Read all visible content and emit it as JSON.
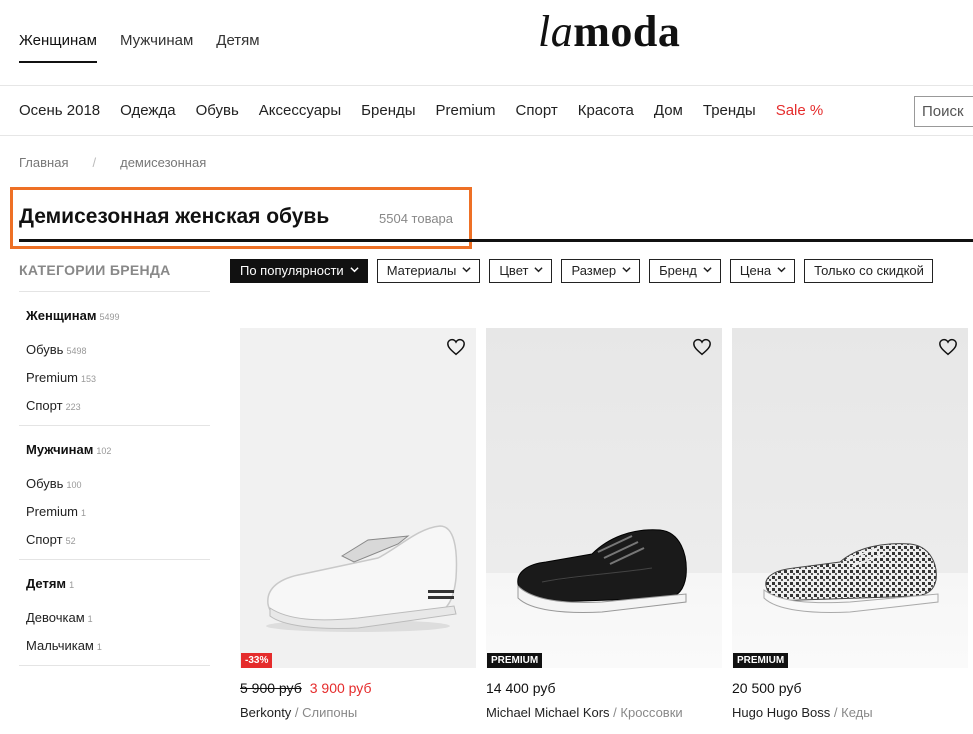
{
  "header": {
    "gender_tabs": [
      "Женщинам",
      "Мужчинам",
      "Детям"
    ],
    "logo": {
      "la": "la",
      "moda": "moda"
    }
  },
  "nav": {
    "items": [
      "Осень 2018",
      "Одежда",
      "Обувь",
      "Аксессуары",
      "Бренды",
      "Premium",
      "Спорт",
      "Красота",
      "Дом",
      "Тренды"
    ],
    "sale": "Sale %",
    "search_text": "Поиск"
  },
  "breadcrumb": {
    "home": "Главная",
    "sep": "/",
    "current": "демисезонная"
  },
  "page": {
    "title": "Демисезонная женская обувь",
    "count": "5504 товара",
    "highlight_color": "#ee7025"
  },
  "sidebar": {
    "heading": "КАТЕГОРИИ БРЕНДА",
    "groups": [
      {
        "title": "Женщинам",
        "count": "5499",
        "items": [
          {
            "label": "Обувь",
            "count": "5498"
          },
          {
            "label": "Premium",
            "count": "153"
          },
          {
            "label": "Спорт",
            "count": "223"
          }
        ]
      },
      {
        "title": "Мужчинам",
        "count": "102",
        "items": [
          {
            "label": "Обувь",
            "count": "100"
          },
          {
            "label": "Premium",
            "count": "1"
          },
          {
            "label": "Спорт",
            "count": "52"
          }
        ]
      },
      {
        "title": "Детям",
        "count": "1",
        "items": [
          {
            "label": "Девочкам",
            "count": "1"
          },
          {
            "label": "Мальчикам",
            "count": "1"
          }
        ]
      }
    ]
  },
  "filters": [
    "По популярности",
    "Материалы",
    "Цвет",
    "Размер",
    "Бренд",
    "Цена",
    "Только со скидкой"
  ],
  "products": [
    {
      "badge": "-33%",
      "old_price": "5 900 руб",
      "price": "3 900 руб",
      "brand": "Berkonty",
      "type": "Слипоны",
      "icons": [
        "heart-icon"
      ]
    },
    {
      "badge": "PREMIUM",
      "price": "14 400 руб",
      "brand": "Michael Michael Kors",
      "type": "Кроссовки",
      "icons": [
        "heart-icon"
      ]
    },
    {
      "badge": "PREMIUM",
      "price": "20 500 руб",
      "brand": "Hugo Hugo Boss",
      "type": "Кеды",
      "icons": [
        "heart-icon"
      ]
    }
  ],
  "colors": {
    "accent_sale": "#e52c2c",
    "dark": "#111111"
  }
}
